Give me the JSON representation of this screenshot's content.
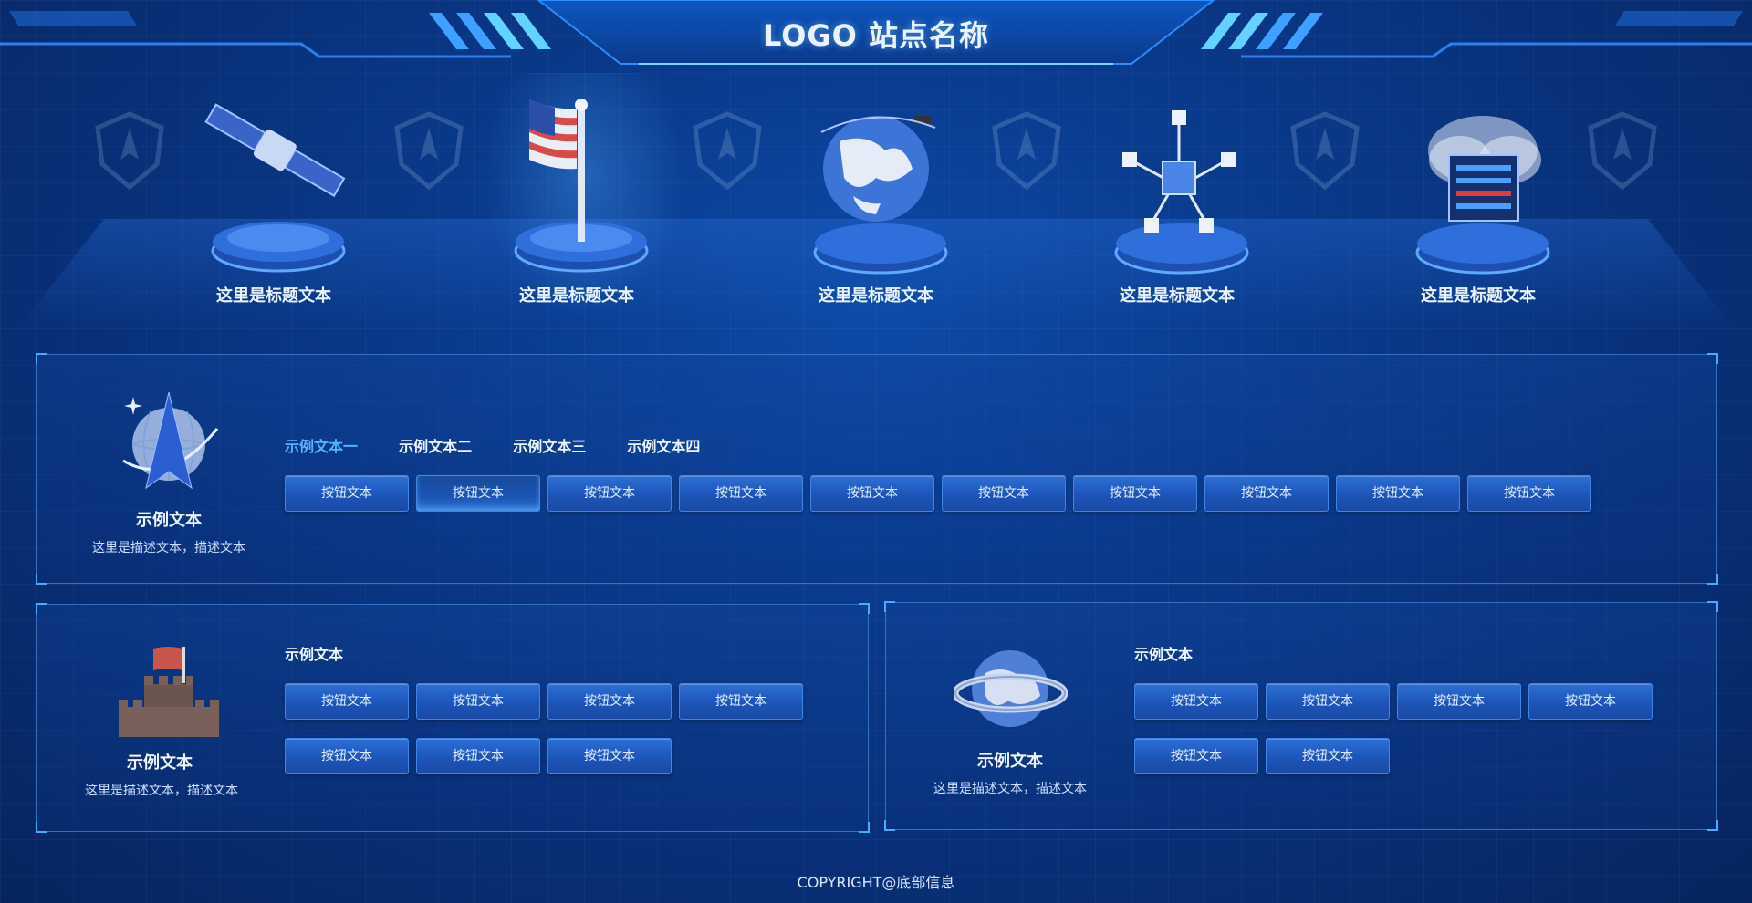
{
  "header": {
    "title": "LOGO 站点名称"
  },
  "nav": {
    "items": [
      {
        "label": "这里是标题文本",
        "icon": "satellite-icon"
      },
      {
        "label": "这里是标题文本",
        "icon": "flag-icon"
      },
      {
        "label": "这里是标题文本",
        "icon": "globe-icon"
      },
      {
        "label": "这里是标题文本",
        "icon": "network-icon"
      },
      {
        "label": "这里是标题文本",
        "icon": "server-cloud-icon"
      }
    ]
  },
  "panel1": {
    "title": "示例文本",
    "desc": "这里是描述文本，描述文本",
    "tabs": [
      "示例文本一",
      "示例文本二",
      "示例文本三",
      "示例文本四"
    ],
    "active_tab": 0,
    "buttons": [
      "按钮文本",
      "按钮文本",
      "按钮文本",
      "按钮文本",
      "按钮文本",
      "按钮文本",
      "按钮文本",
      "按钮文本",
      "按钮文本",
      "按钮文本"
    ],
    "selected_button": 1
  },
  "panel2": {
    "title": "示例文本",
    "desc": "这里是描述文本，描述文本",
    "section_title": "示例文本",
    "buttons": [
      "按钮文本",
      "按钮文本",
      "按钮文本",
      "按钮文本",
      "按钮文本",
      "按钮文本",
      "按钮文本"
    ]
  },
  "panel3": {
    "title": "示例文本",
    "desc": "这里是描述文本，描述文本",
    "section_title": "示例文本",
    "buttons": [
      "按钮文本",
      "按钮文本",
      "按钮文本",
      "按钮文本",
      "按钮文本",
      "按钮文本"
    ]
  },
  "footer": {
    "copyright": "COPYRIGHT@底部信息"
  },
  "colors": {
    "accent": "#56b4ff",
    "background": "#0a3a8c",
    "button": "#1d55b8"
  }
}
